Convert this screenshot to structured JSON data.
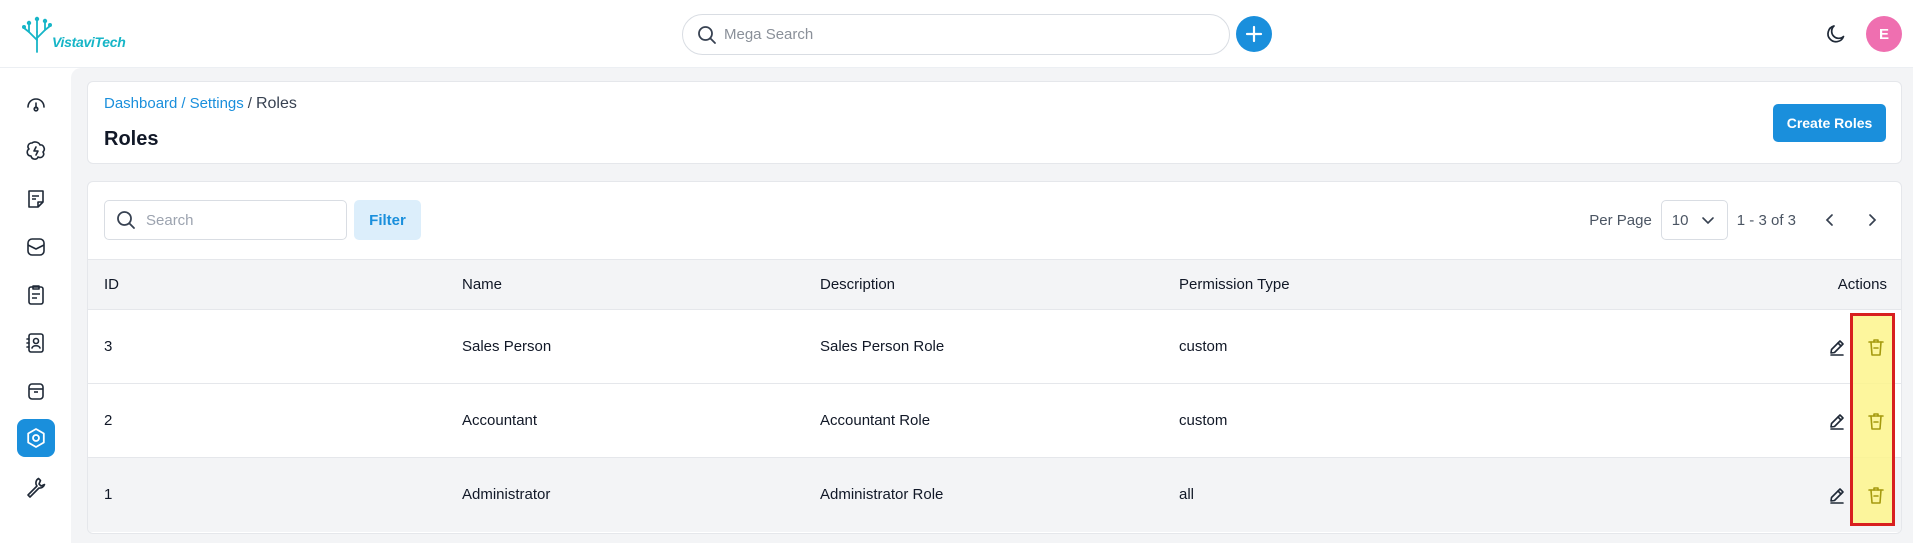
{
  "brand": {
    "name": "VistaviTech",
    "color": "#16b5c7"
  },
  "topbar": {
    "search_placeholder": "Mega Search",
    "add_icon": "plus-icon",
    "theme_icon": "moon-icon",
    "avatar_letter": "E",
    "avatar_color": "#ef6fb0"
  },
  "sidebar": {
    "items": [
      {
        "icon": "gauge-icon",
        "active": false
      },
      {
        "icon": "ai-icon",
        "active": false
      },
      {
        "icon": "note-icon",
        "active": false
      },
      {
        "icon": "mail-icon",
        "active": false
      },
      {
        "icon": "clipboard-icon",
        "active": false
      },
      {
        "icon": "contacts-icon",
        "active": false
      },
      {
        "icon": "archive-icon",
        "active": false
      },
      {
        "icon": "settings-icon",
        "active": true
      },
      {
        "icon": "wrench-icon",
        "active": false
      }
    ]
  },
  "header": {
    "breadcrumb": {
      "dashboard": "Dashboard",
      "settings": "Settings",
      "current": "Roles",
      "sep": "/"
    },
    "title": "Roles",
    "create_button": "Create Roles"
  },
  "toolbar": {
    "search_placeholder": "Search",
    "filter_label": "Filter",
    "per_page_label": "Per Page",
    "per_page_value": "10",
    "range_text": "1 - 3 of 3"
  },
  "table": {
    "columns": [
      "ID",
      "Name",
      "Description",
      "Permission Type",
      "Actions"
    ],
    "rows": [
      {
        "id": "3",
        "name": "Sales Person",
        "description": "Sales Person Role",
        "permission": "custom"
      },
      {
        "id": "2",
        "name": "Accountant",
        "description": "Accountant Role",
        "permission": "custom"
      },
      {
        "id": "1",
        "name": "Administrator",
        "description": "Administrator Role",
        "permission": "all"
      }
    ]
  },
  "colors": {
    "accent": "#1a8fdc",
    "highlight_fill": "#fdf58c",
    "highlight_border": "#d81f1f",
    "trash_icon": "#a59a0e"
  }
}
